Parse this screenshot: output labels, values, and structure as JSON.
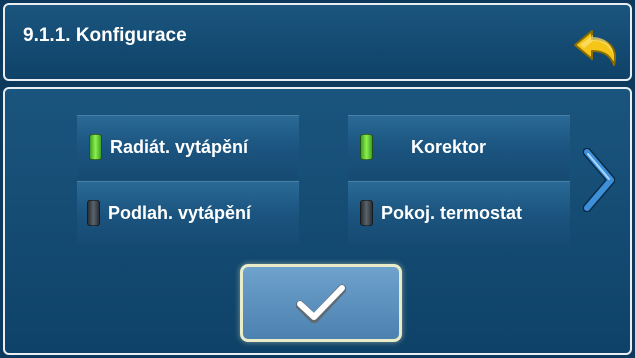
{
  "header": {
    "title": "9.1.1. Konfigurace",
    "back_icon": "back-arrow-icon",
    "back_color": "#f5c518"
  },
  "options": [
    {
      "label": "Radiát. vytápění",
      "state": "on"
    },
    {
      "label": "Korektor",
      "state": "on"
    },
    {
      "label": "Podlah. vytápění",
      "state": "off"
    },
    {
      "label": "Pokoj. termostat",
      "state": "off"
    }
  ],
  "next_icon": "chevron-right-icon",
  "confirm_icon": "checkmark-icon",
  "colors": {
    "led_on": "#8ef04a",
    "led_off": "#5a636b",
    "panel": "#1a557e",
    "border": "#e8eef2"
  }
}
